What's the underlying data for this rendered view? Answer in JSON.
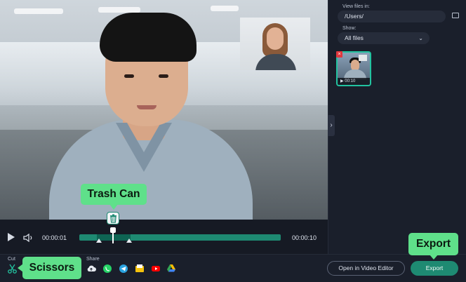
{
  "preview": {
    "playback_time": "00:00:01",
    "total_time": "00:00:10",
    "timeline_progress": 0.17
  },
  "right_panel": {
    "view_files_label": "View files in:",
    "path_value": "/Users/",
    "show_label": "Show:",
    "show_value": "All files",
    "thumbnail_duration": "00:10"
  },
  "bottom_bar": {
    "cut_label": "Cut",
    "share_label": "Share",
    "share_icons": [
      "cloud-upload-icon",
      "whatsapp-icon",
      "telegram-icon",
      "google-drive-file-icon",
      "youtube-icon",
      "google-drive-icon"
    ],
    "open_editor_label": "Open in Video Editor",
    "export_label": "Export"
  },
  "callouts": {
    "trash_can": "Trash Can",
    "export": "Export",
    "scissors": "Scissors"
  },
  "colors": {
    "accent": "#1e8a72",
    "callout": "#5fe08a",
    "background": "#161a24"
  }
}
